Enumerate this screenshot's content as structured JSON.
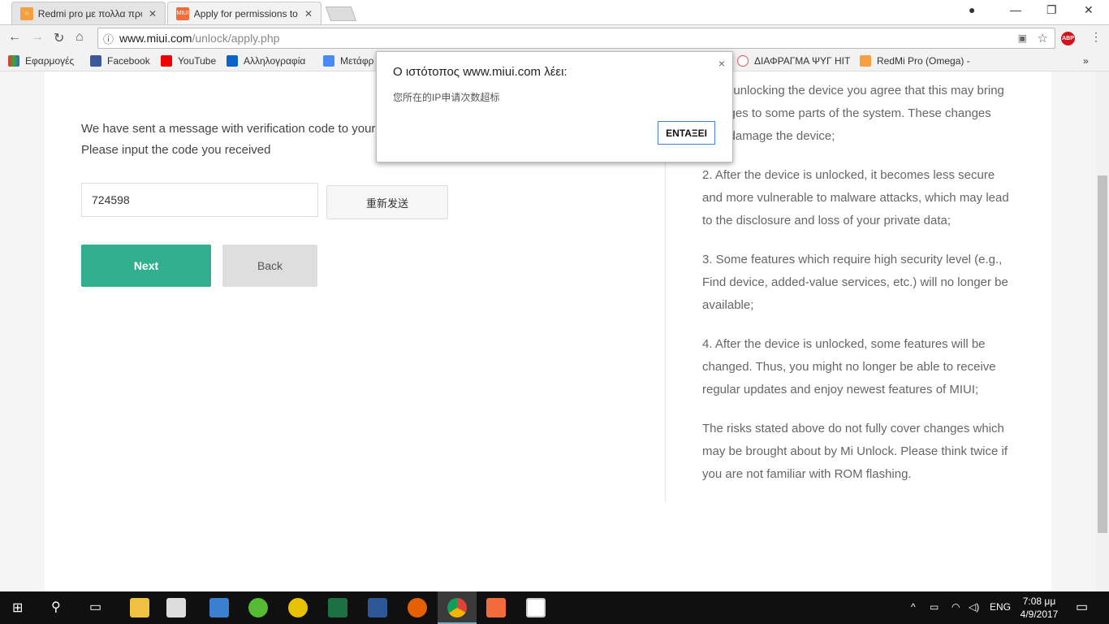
{
  "browser": {
    "tabs": [
      {
        "title": "Redmi pro με πολλα προ",
        "active": false
      },
      {
        "title": "Apply for permissions to",
        "active": true,
        "favicon_text": "MIUI"
      }
    ],
    "url_host": "www.miui.com",
    "url_path": "/unlock/apply.php",
    "bookmarks": [
      "Εφαρμογές",
      "Facebook",
      "YouTube",
      "Αλληλογραφία",
      "Μετάφρ",
      "ΔΙΑΦΡΑΓΜΑ ΨΥΓ ΗΙΤ",
      "RedMi Pro (Omega) -"
    ],
    "abp_label": "ABP",
    "more_bookmarks": "»"
  },
  "page": {
    "message_line1": "We have sent a message with verification code to your",
    "message_line2": "Please input the code you received",
    "code_value": "724598",
    "resend_label": "重新发送",
    "next_label": "Next",
    "back_label": "Back",
    "terms": [
      "1. By unlocking the device you agree that this may bring changes to some parts of the system. These changes may damage the device;",
      "2. After the device is unlocked, it becomes less secure and more vulnerable to malware attacks, which may lead to the disclosure and loss of your private data;",
      "3. Some features which require high security level (e.g., Find device, added-value services, etc.) will no longer be available;",
      "4. After the device is unlocked, some features will be changed. Thus, you might no longer be able to receive regular updates and enjoy newest features of MIUI;",
      "The risks stated above do not fully cover changes which may be brought about by Mi Unlock. Please think twice if you are not familiar with ROM flashing."
    ]
  },
  "dialog": {
    "title": "Ο ιστότοπος www.miui.com λέει:",
    "message": "您所在的IP申请次数超标",
    "ok_label": "ΕΝΤΑΞΕΙ",
    "close": "×"
  },
  "taskbar": {
    "lang": "ENG",
    "time": "7:08 μμ",
    "date": "4/9/2017"
  },
  "colors": {
    "accent": "#32af8f"
  }
}
